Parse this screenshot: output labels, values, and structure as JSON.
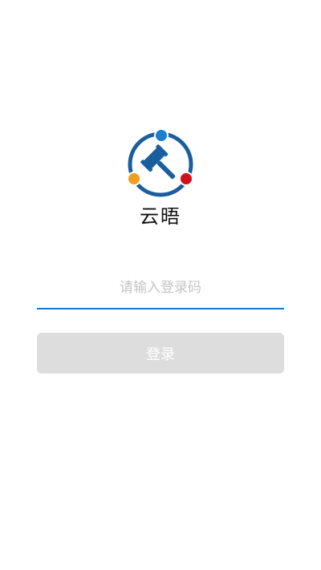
{
  "app": {
    "name": "云晤"
  },
  "login": {
    "code_input": {
      "value": "",
      "placeholder": "请输入登录码"
    },
    "submit_label": "登录"
  },
  "logo": {
    "icon": "gavel-icon",
    "colors": {
      "ring": "#1a5e9e",
      "gavel": "#1a5e9e",
      "dot_top": "#1a7fd0",
      "dot_left": "#f0a020",
      "dot_right": "#d0101a"
    }
  },
  "theme": {
    "accent": "#1a74c9",
    "button_disabled_bg": "#dddddd",
    "placeholder_color": "#c4c4c4"
  }
}
